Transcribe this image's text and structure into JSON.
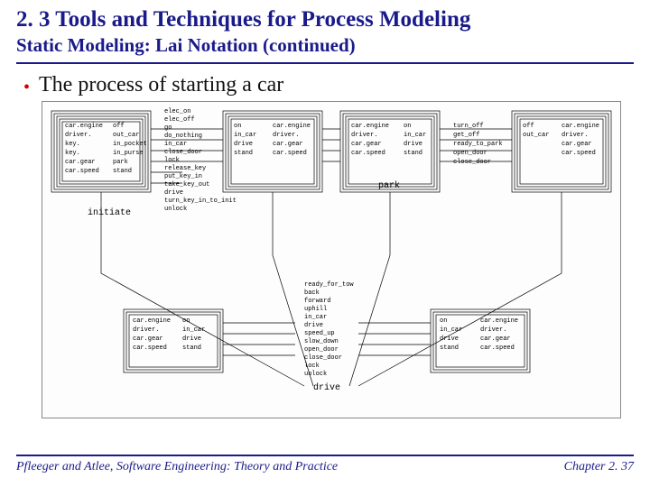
{
  "title": "2. 3 Tools and Techniques for Process Modeling",
  "subtitle": "Static Modeling: Lai Notation (continued)",
  "bullet": "The process of starting a car",
  "footer": {
    "left": "Pfleeger and Atlee, Software Engineering: Theory and Practice",
    "right": "Chapter 2. 37"
  },
  "diagram": {
    "state_labels": [
      "initiate",
      "park",
      "drive"
    ],
    "boxes": {
      "top_left": [
        [
          "car.engine",
          "off"
        ],
        [
          "driver.",
          "out_car"
        ],
        [
          "key.",
          "in_pocket"
        ],
        [
          "key.",
          "in_purse"
        ],
        [
          "car.gear",
          "park"
        ],
        [
          "car.speed",
          "stand"
        ]
      ],
      "top_mid_actions": [
        "elec_on",
        "elec_off",
        "go",
        "do_nothing",
        "in_car",
        "close_door",
        "lock",
        "release_key",
        "put_key_in",
        "take_key_out",
        "drive",
        "turn_key_in_to_init",
        "unlock"
      ],
      "top_mid_pair_left": [
        [
          "on",
          "car.engine"
        ],
        [
          "in_car",
          "driver."
        ],
        [
          "drive",
          "car.gear"
        ],
        [
          "stand",
          "car.speed"
        ]
      ],
      "top_mid_pair_right": [
        [
          "car.engine",
          "on"
        ],
        [
          "driver.",
          "in_car"
        ],
        [
          "car.gear",
          "drive"
        ],
        [
          "car.speed",
          "stand"
        ]
      ],
      "top_right_actions": [
        "turn_off",
        "get_off",
        "ready_to_park",
        "open_door",
        "close_door"
      ],
      "top_right_pair": [
        [
          "off",
          "car.engine"
        ],
        [
          "out_car",
          "driver."
        ],
        [
          "",
          "car.gear"
        ],
        [
          "",
          "car.speed"
        ]
      ],
      "bottom_left": [
        [
          "car.engine",
          "on"
        ],
        [
          "driver.",
          "in_car"
        ],
        [
          "car.gear",
          "drive"
        ],
        [
          "car.speed",
          "stand"
        ]
      ],
      "bottom_mid_actions": [
        "ready_for_tow",
        "back",
        "forward",
        "uphill",
        "in_car",
        "drive",
        "speed_up",
        "slow_down",
        "open_door",
        "close_door",
        "lock",
        "unlock"
      ],
      "bottom_right": [
        [
          "on",
          "car.engine"
        ],
        [
          "in_car",
          "driver."
        ],
        [
          "drive",
          "car.gear"
        ],
        [
          "stand",
          "car.speed"
        ]
      ]
    }
  }
}
